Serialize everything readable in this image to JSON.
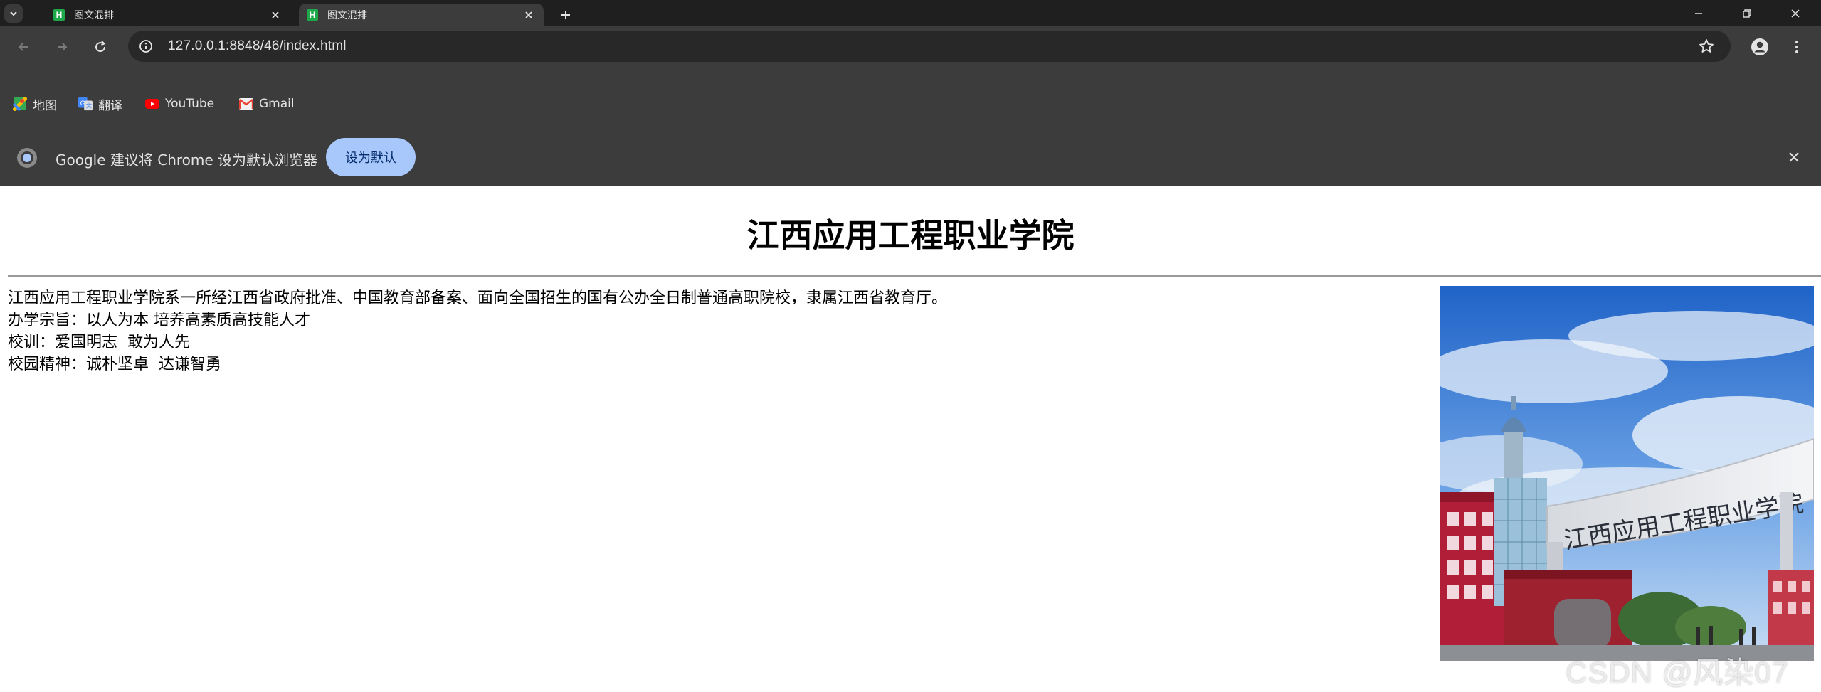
{
  "tabs": [
    {
      "title": "图文混排",
      "favicon": "H"
    },
    {
      "title": "图文混排",
      "favicon": "H"
    }
  ],
  "address_bar": {
    "url": "127.0.0.1:8848/46/index.html"
  },
  "bookmarks": [
    {
      "label": "地图",
      "icon": "maps-icon"
    },
    {
      "label": "翻译",
      "icon": "translate-icon"
    },
    {
      "label": "YouTube",
      "icon": "youtube-icon"
    },
    {
      "label": "Gmail",
      "icon": "gmail-icon"
    }
  ],
  "infobar": {
    "message": "Google 建议将 Chrome 设为默认浏览器",
    "button_label": "设为默认"
  },
  "page": {
    "heading": "江西应用工程职业学院",
    "lines": [
      "江西应用工程职业学院系一所经江西省政府批准、中国教育部备案、面向全国招生的国有公办全日制普通高职院校，隶属江西省教育厅。",
      "办学宗旨：以人为本 培养高素质高技能人才",
      "校训：爱国明志  敢为人先",
      "校园精神：诚朴坚卓  达谦智勇"
    ],
    "image": {
      "gate_sign": "江西应用工程职业学院"
    }
  },
  "watermark": "CSDN @风染07",
  "colors": {
    "tabstrip_bg": "#1f1f1f",
    "toolbar_bg": "#3c3c3c",
    "omnibox_bg": "#282828",
    "button_accent": "#a8c7fa",
    "favicon_green": "#1fa84a"
  }
}
